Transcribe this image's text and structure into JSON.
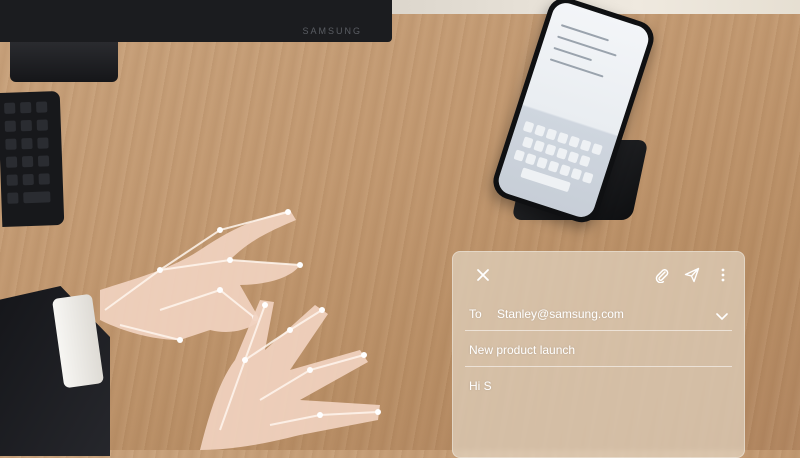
{
  "monitor": {
    "brand": "SAMSUNG"
  },
  "email": {
    "to_label": "To",
    "to_value": "Stanley@samsung.com",
    "subject": "New product launch",
    "body": "Hi S",
    "icons": {
      "close": "close-icon",
      "attach": "paperclip-icon",
      "send": "send-icon",
      "more": "more-vertical-icon",
      "expand": "chevron-down-icon"
    }
  },
  "colors": {
    "desk": "#c39a72",
    "panel": "#e9decf",
    "text": "#ffffff"
  }
}
